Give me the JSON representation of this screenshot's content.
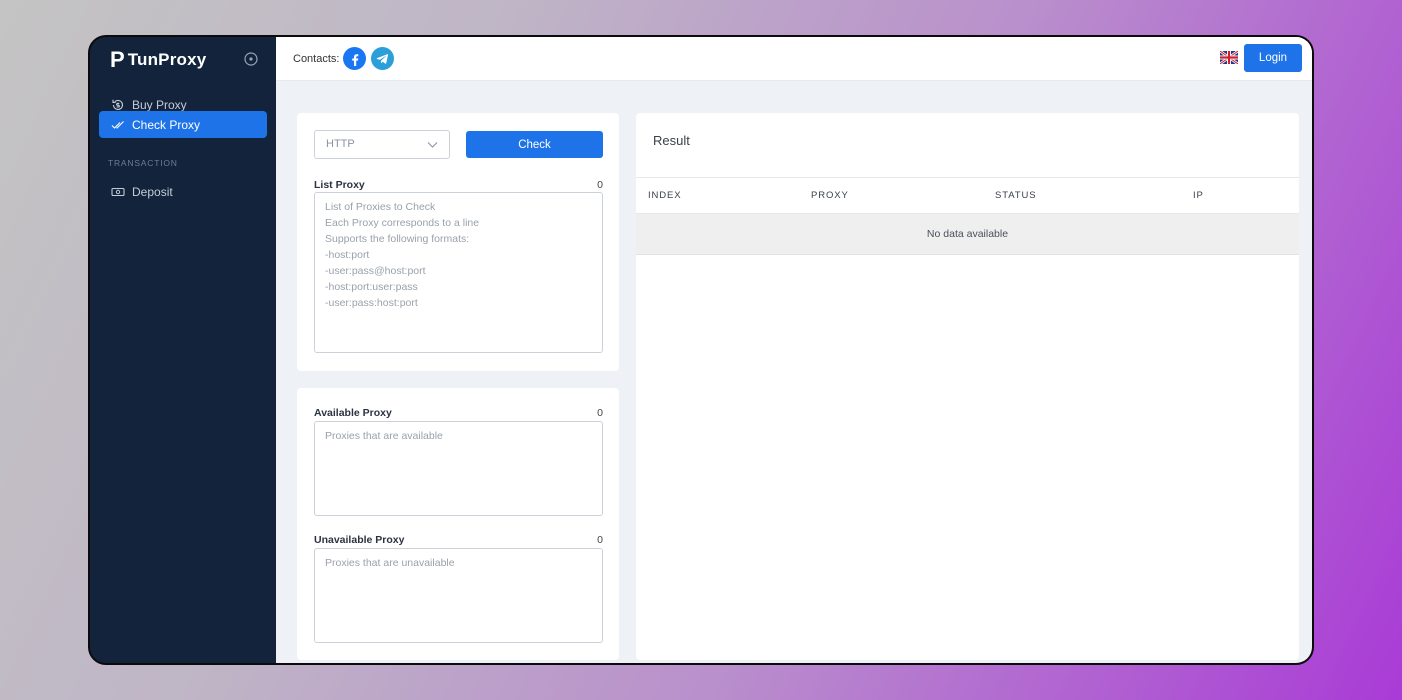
{
  "brand": {
    "mark": "P",
    "name": "TunProxy"
  },
  "sidebar": {
    "items": [
      {
        "label": "Buy Proxy",
        "icon": "refresh-dollar-icon"
      },
      {
        "label": "Check Proxy",
        "icon": "double-check-icon",
        "active": true
      }
    ],
    "section_label": "TRANSACTION",
    "section_items": [
      {
        "label": "Deposit",
        "icon": "cash-icon"
      }
    ]
  },
  "topbar": {
    "contacts_label": "Contacts:",
    "login_label": "Login"
  },
  "checker": {
    "protocol": "HTTP",
    "check_label": "Check",
    "list_label": "List Proxy",
    "list_count": "0",
    "list_placeholder": "List of Proxies to Check\nEach Proxy corresponds to a line\nSupports the following formats:\n-host:port\n-user:pass@host:port\n-host:port:user:pass\n-user:pass:host:port",
    "available_label": "Available Proxy",
    "available_count": "0",
    "available_placeholder": "Proxies that are available",
    "unavailable_label": "Unavailable Proxy",
    "unavailable_count": "0",
    "unavailable_placeholder": "Proxies that are unavailable"
  },
  "result": {
    "title": "Result",
    "columns": [
      "INDEX",
      "PROXY",
      "STATUS",
      "IP"
    ],
    "empty_text": "No data available"
  },
  "colors": {
    "accent": "#1e73e8",
    "sidebar": "#12233b",
    "facebook": "#1977f2",
    "telegram": "#2a9fd9"
  }
}
